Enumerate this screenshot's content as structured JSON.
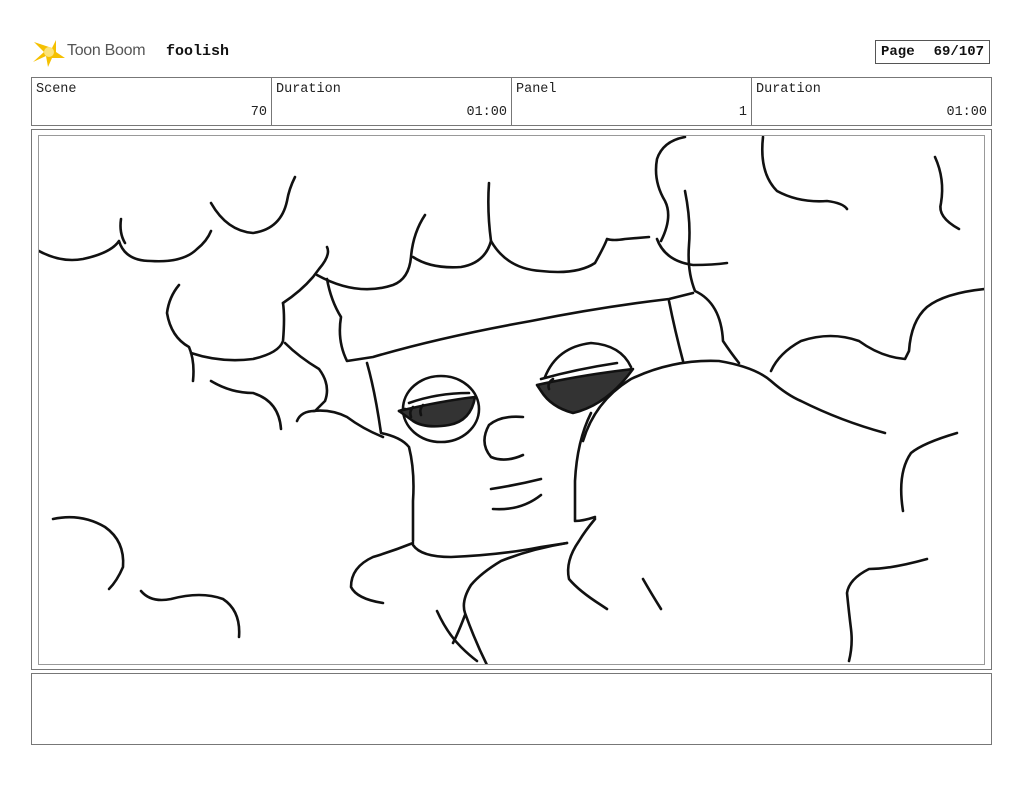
{
  "header": {
    "logo_text": "Toon Boom",
    "project_name": "foolish",
    "page_label": "Page",
    "page_value": "69/107"
  },
  "info": [
    {
      "label": "Scene",
      "value": "70"
    },
    {
      "label": "Duration",
      "value": "01:00"
    },
    {
      "label": "Panel",
      "value": "1"
    },
    {
      "label": "Duration",
      "value": "01:00"
    }
  ],
  "notes": {
    "text": ""
  },
  "colors": {
    "logo_yellow": "#f5c000",
    "line": "#111111",
    "glasses": "#333333"
  }
}
